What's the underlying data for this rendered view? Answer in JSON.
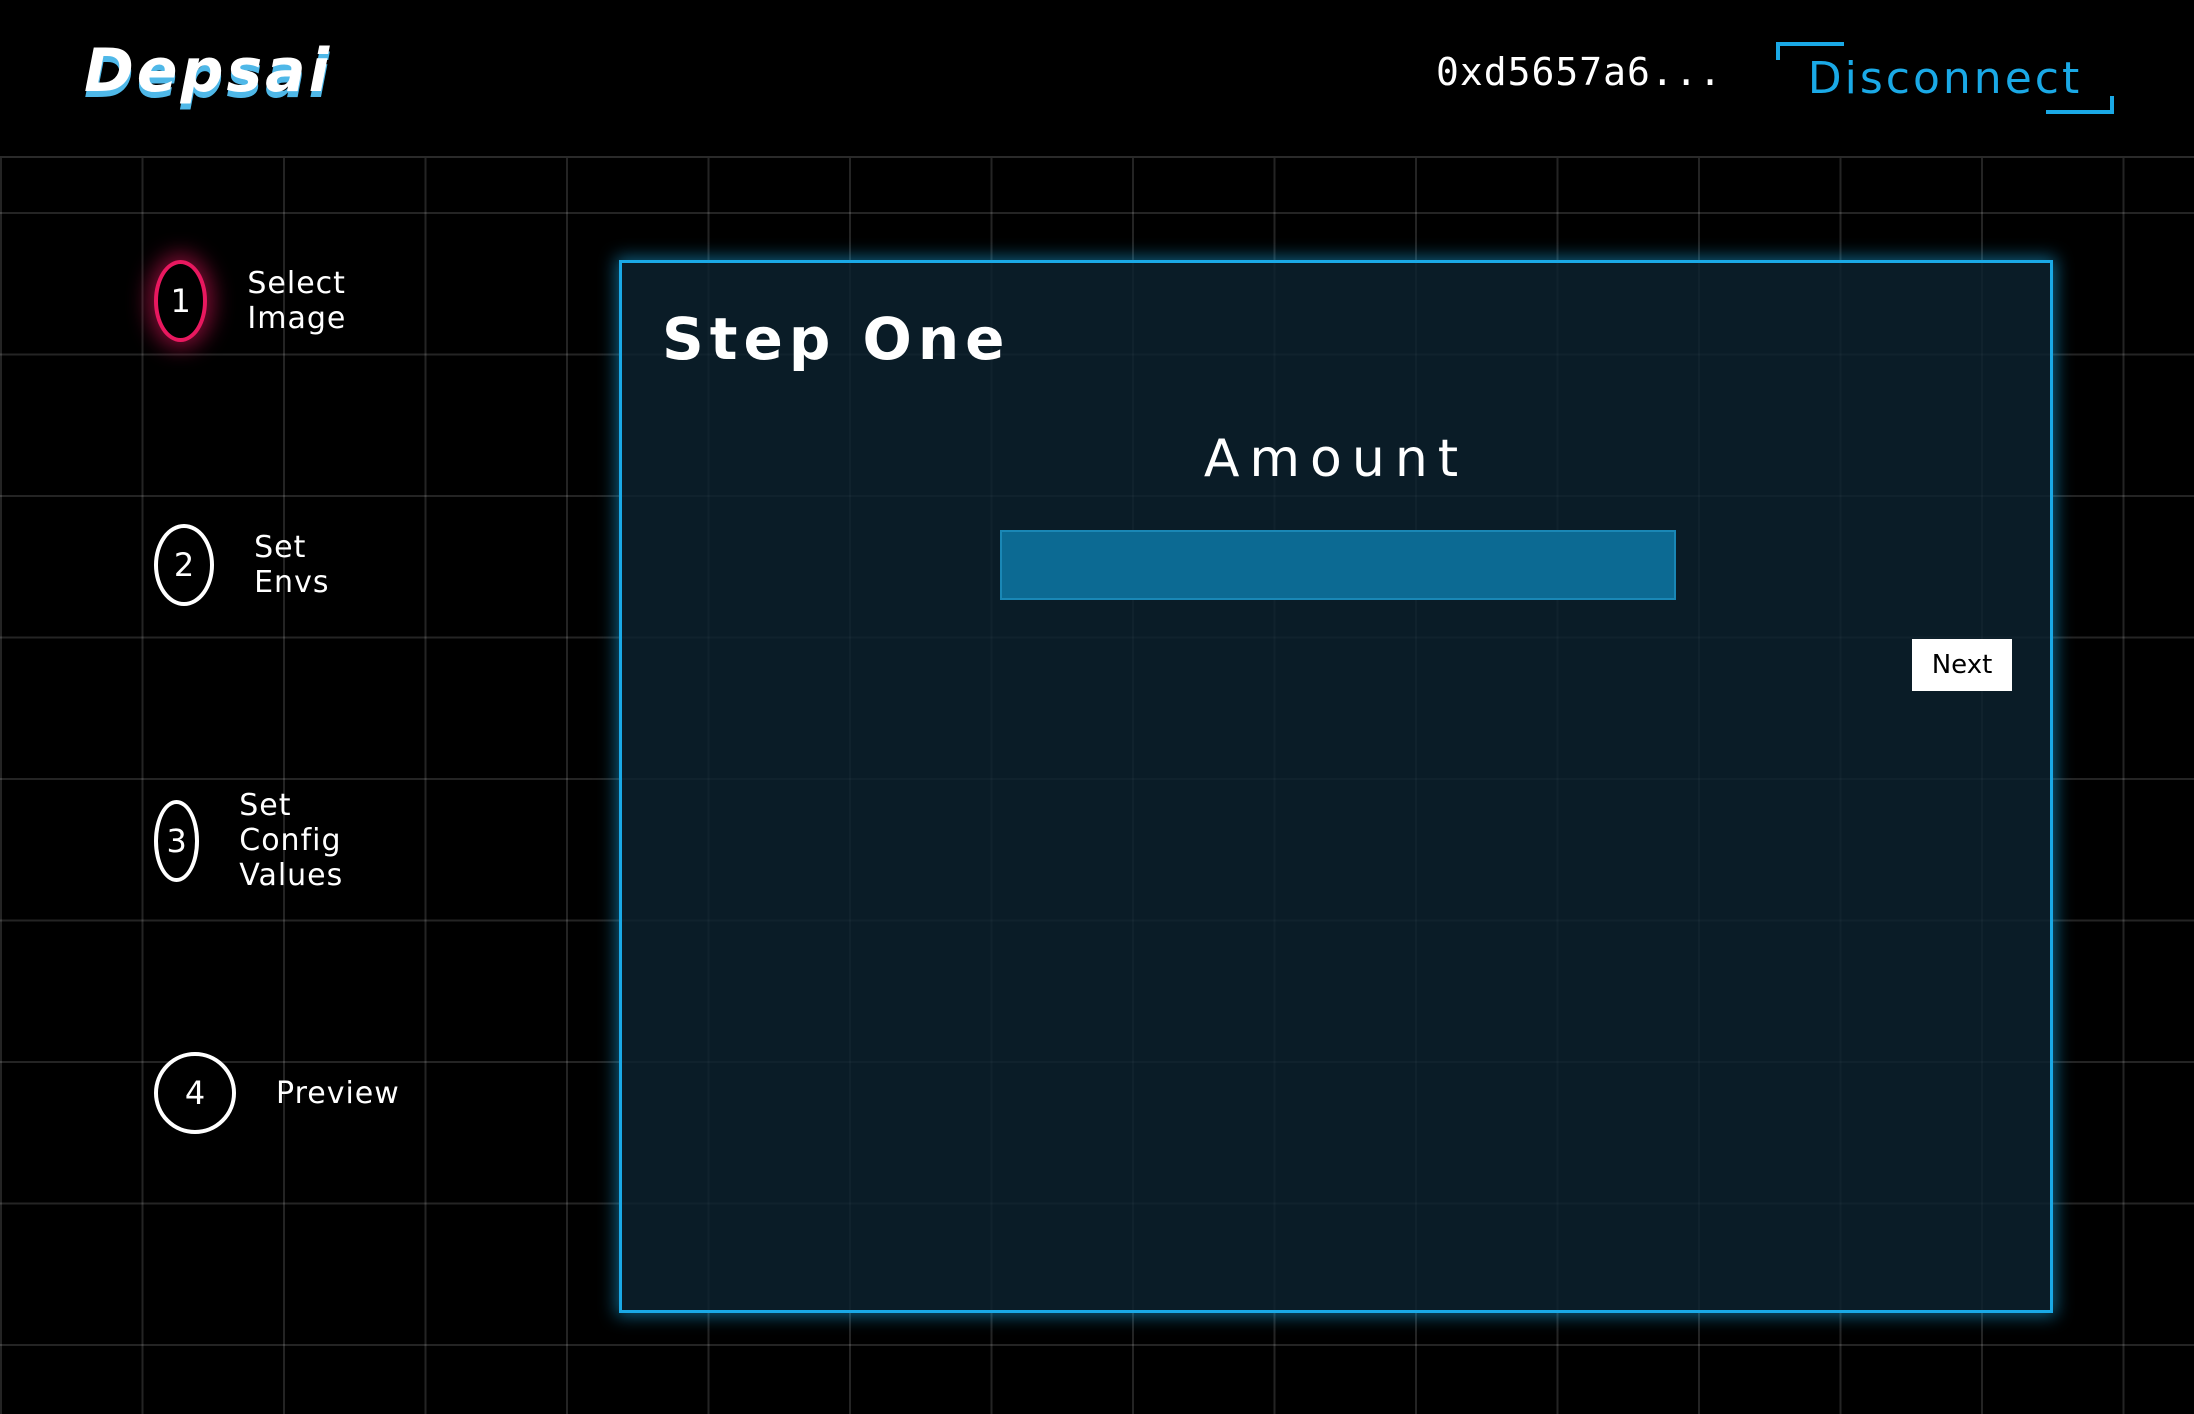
{
  "header": {
    "logo": "Depsai",
    "wallet_address": "0xd5657a6...",
    "disconnect_label": "Disconnect"
  },
  "steps": [
    {
      "number": "1",
      "label": "Select Image",
      "active": true
    },
    {
      "number": "2",
      "label": "Set Envs",
      "active": false
    },
    {
      "number": "3",
      "label": "Set Config Values",
      "active": false
    },
    {
      "number": "4",
      "label": "Preview",
      "active": false
    }
  ],
  "panel": {
    "title": "Step One",
    "amount_label": "Amount",
    "amount_value": "",
    "next_label": "Next"
  },
  "colors": {
    "accent": "#1aa9e6",
    "active_step": "#e8185f",
    "background": "#000000",
    "panel_bg": "#0c2230",
    "input_bg": "#0c6a93"
  }
}
